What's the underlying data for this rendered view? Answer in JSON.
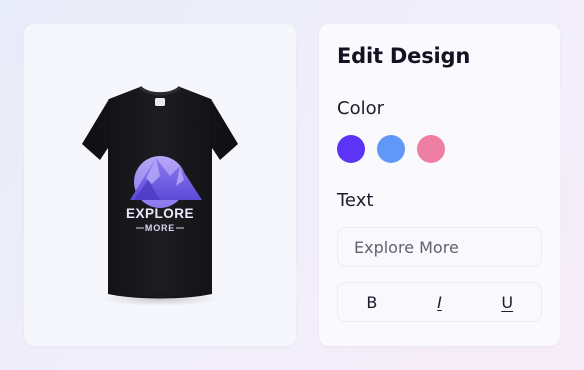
{
  "preview": {
    "shirt_color": "#16161a",
    "graphic": {
      "line1": "EXPLORE",
      "line2": "MORE"
    }
  },
  "editor": {
    "title": "Edit Design",
    "color_label": "Color",
    "swatches": [
      {
        "name": "violet",
        "hex": "#5b34f6"
      },
      {
        "name": "blue",
        "hex": "#6198f7"
      },
      {
        "name": "pink",
        "hex": "#ee7fa3"
      }
    ],
    "text_label": "Text",
    "text_value": "Explore More",
    "format": {
      "bold": "B",
      "italic": "I",
      "underline": "U"
    }
  },
  "colors": {
    "background": "#eef0fa",
    "card": "#f7f8fd",
    "title": "#121222"
  }
}
